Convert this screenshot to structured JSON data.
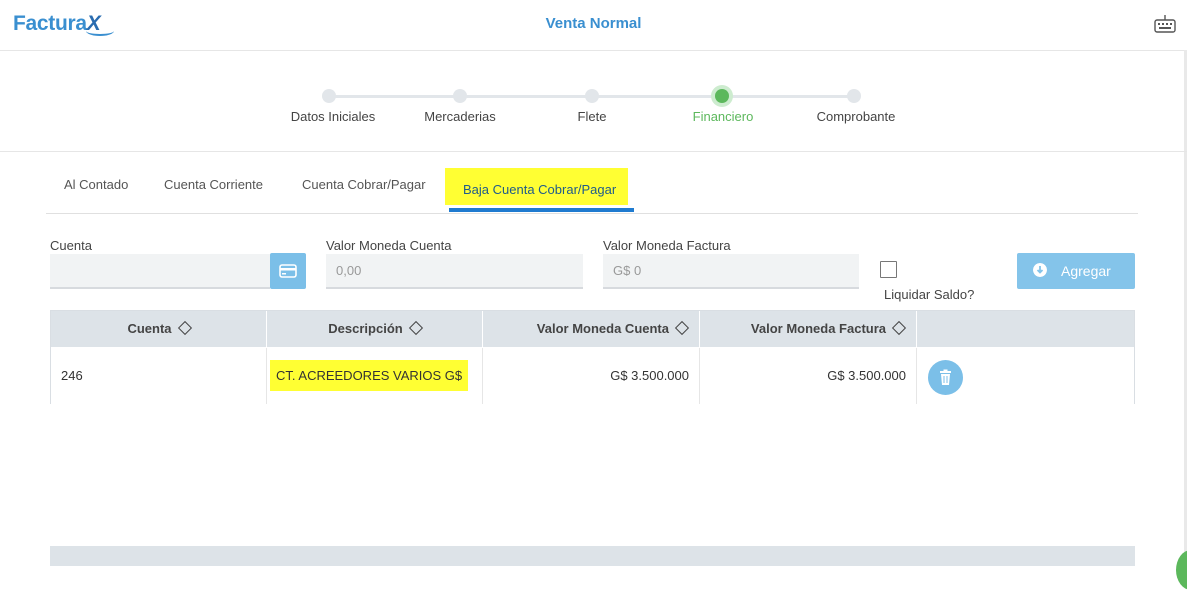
{
  "header": {
    "logo_text": "Factura",
    "logo_x": "X",
    "title": "Venta Normal",
    "keyboard_icon": "keyboard-icon"
  },
  "stepper": {
    "steps": [
      {
        "label": "Datos Iniciales",
        "active": false
      },
      {
        "label": "Mercaderias",
        "active": false
      },
      {
        "label": "Flete",
        "active": false
      },
      {
        "label": "Financiero",
        "active": true
      },
      {
        "label": "Comprobante",
        "active": false
      }
    ],
    "active_color": "#5cb85c"
  },
  "tabs": [
    {
      "label": "Al Contado"
    },
    {
      "label": "Cuenta Corriente"
    },
    {
      "label": "Cuenta Cobrar/Pagar"
    },
    {
      "label": "Baja Cuenta Cobrar/Pagar",
      "active": true
    }
  ],
  "form": {
    "cuenta_label": "Cuenta",
    "cuenta_value": "",
    "valor_cuenta_label": "Valor Moneda Cuenta",
    "valor_cuenta_placeholder": "0,00",
    "valor_factura_label": "Valor Moneda Factura",
    "valor_factura_placeholder": "G$ 0",
    "liquidar_label": "Liquidar Saldo?",
    "liquidar_checked": false,
    "add_label": "Agregar"
  },
  "table": {
    "headers": [
      "Cuenta",
      "Descripción",
      "Valor Moneda Cuenta",
      "Valor Moneda Factura",
      ""
    ],
    "rows": [
      {
        "cuenta": "246",
        "descripcion": "CT. ACREEDORES VARIOS G$",
        "valor_cuenta": "G$ 3.500.000",
        "valor_factura": "G$ 3.500.000"
      }
    ]
  },
  "colors": {
    "accent": "#3a8fd0",
    "button": "#84c4ea",
    "highlight": "#ffff33",
    "tab_underline": "#1f7bd0"
  }
}
